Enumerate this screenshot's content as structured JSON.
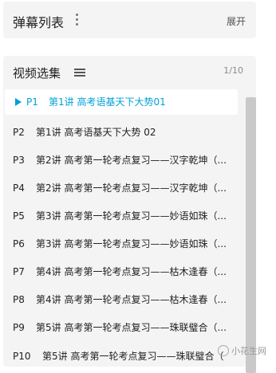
{
  "danmaku": {
    "title": "弹幕列表",
    "expand_label": "展开"
  },
  "episodes": {
    "title": "视频选集",
    "page_count": "1/10",
    "items": [
      {
        "num": "P1",
        "title": "第1讲 高考语基天下大势01",
        "active": true
      },
      {
        "num": "P2",
        "title": "第1讲 高考语基天下大势 02"
      },
      {
        "num": "P3",
        "title": "第2讲 高考第一轮考点复习——汉字乾坤（..."
      },
      {
        "num": "P4",
        "title": "第2讲 高考第一轮考点复习——汉字乾坤（..."
      },
      {
        "num": "P5",
        "title": "第3讲 高考第一轮考点复习——妙语如珠（..."
      },
      {
        "num": "P6",
        "title": "第3讲 高考第一轮考点复习——妙语如珠（..."
      },
      {
        "num": "P7",
        "title": "第4讲 高考第一轮考点复习——枯木逢春（..."
      },
      {
        "num": "P8",
        "title": "第4讲 高考第一轮考点复习——枯木逢春（..."
      },
      {
        "num": "P9",
        "title": "第5讲 高考第一轮考点复习——珠联璧合（..."
      },
      {
        "num": "P10",
        "title": "第5讲 高考第一轮考点复习——珠联璧合（"
      }
    ]
  },
  "watermark": "小花生网",
  "colors": {
    "accent": "#00a1d6",
    "panel_bg": "#f4f4f4",
    "scrollbar": "#c9c9c9"
  }
}
